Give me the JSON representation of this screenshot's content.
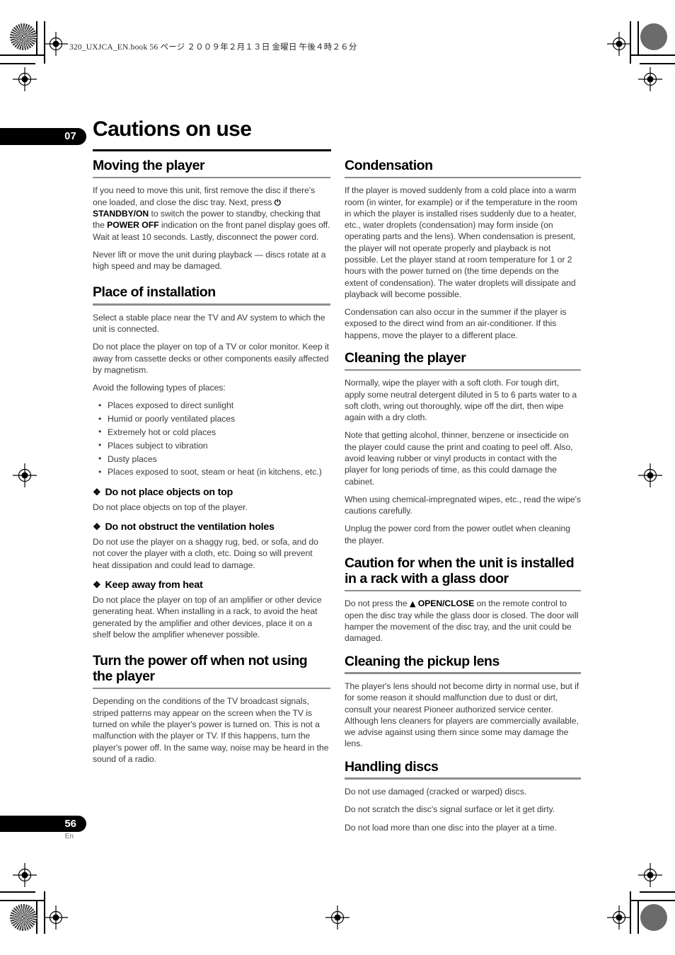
{
  "document": {
    "file_header": "320_UXJCA_EN.book   56 ページ   ２００９年２月１３日   金曜日   午後４時２６分",
    "chapter_number": "07",
    "page_title": "Cautions on use",
    "page_number": "56",
    "language_code": "En"
  },
  "left_column": {
    "moving": {
      "heading": "Moving the player",
      "p1_part1": "If you need to move this unit, first remove the disc if there's one loaded, and close the disc tray. Next, press ",
      "p1_power_icon": "⏻",
      "p1_bold1": "STANDBY/ON",
      "p1_part2": " to switch the power to standby, checking that the ",
      "p1_bold2": "POWER OFF",
      "p1_part3": " indication on the front panel display goes off. Wait at least 10 seconds. Lastly, disconnect the power cord.",
      "p2": "Never lift or move the unit during playback — discs rotate at a high speed and may be damaged."
    },
    "place": {
      "heading": "Place of installation",
      "p1": "Select a stable place near the TV and AV system to which the unit is connected.",
      "p2": "Do not place the player on top of a TV or color monitor. Keep it away from cassette decks or other components easily affected by magnetism.",
      "p3": "Avoid the following types of places:",
      "bullets": [
        "Places exposed to direct sunlight",
        "Humid or poorly ventilated places",
        "Extremely hot or cold places",
        "Places subject to vibration",
        "Dusty places",
        "Places exposed to soot, steam or heat (in kitchens, etc.)"
      ],
      "sub1": {
        "floret": "❖",
        "title": "Do not place objects on top",
        "body": "Do not place objects on top of the player."
      },
      "sub2": {
        "floret": "❖",
        "title": "Do not obstruct the ventilation holes",
        "body": "Do not use the player on a shaggy rug, bed, or sofa, and do not cover the player with a cloth, etc. Doing so will prevent heat dissipation and could lead to damage."
      },
      "sub3": {
        "floret": "❖",
        "title": "Keep away from heat",
        "body": "Do not place the player on top of an amplifier or other device generating heat. When installing in a rack, to avoid the heat generated by the amplifier and other devices, place it on a shelf below the amplifier whenever possible."
      }
    },
    "turn_off": {
      "heading": "Turn the power off when not using the player",
      "p1": "Depending on the conditions of the TV broadcast signals, striped patterns may appear on the screen when the TV is turned on while the player's power is turned on. This is not a malfunction with the player or TV. If this happens, turn the player's power off. In the same way, noise may be heard in the sound of a radio."
    }
  },
  "right_column": {
    "condensation": {
      "heading": "Condensation",
      "p1": "If the player is moved suddenly from a cold place into a warm room (in winter, for example) or if the temperature in the room in which the player is installed rises suddenly due to a heater, etc., water droplets (condensation) may form inside (on operating parts and the lens). When condensation is present, the player will not operate properly and playback is not possible. Let the player stand at room temperature for 1 or 2 hours with the power turned on (the time depends on the extent of condensation). The water droplets will dissipate and playback will become possible.",
      "p2": "Condensation can also occur in the summer if the player is exposed to the direct wind from an air-conditioner. If this happens, move the player to a different place."
    },
    "cleaning_player": {
      "heading": "Cleaning the player",
      "p1": "Normally, wipe the player with a soft cloth. For tough dirt, apply some neutral detergent diluted in 5 to 6 parts water to a soft cloth, wring out thoroughly, wipe off the dirt, then wipe again with a dry cloth.",
      "p2": "Note that getting alcohol, thinner, benzene or insecticide on the player could cause the print and coating to peel off. Also, avoid leaving rubber or vinyl products in contact with the player for long periods of time, as this could damage the cabinet.",
      "p3": "When using chemical-impregnated wipes, etc., read the wipe's cautions carefully.",
      "p4": "Unplug the power cord from the power outlet when cleaning the player."
    },
    "glass_door": {
      "heading": "Caution for when the unit is installed in a rack with a glass door",
      "p1_part1": "Do not press the ",
      "p1_eject_icon": "▲",
      "p1_bold": "OPEN/CLOSE",
      "p1_part2": " on the remote control to open the disc tray while the glass door is closed. The door will hamper the movement of the disc tray, and the unit could be damaged."
    },
    "pickup_lens": {
      "heading": "Cleaning the pickup lens",
      "p1": "The player's lens should not become dirty in normal use, but if for some reason it should malfunction due to dust or dirt, consult your nearest Pioneer authorized service center. Although lens cleaners for players are commercially available, we advise against using them since some may damage the lens."
    },
    "handling_discs": {
      "heading": "Handling discs",
      "p1": "Do not use damaged (cracked or warped) discs.",
      "p2": "Do not scratch the disc's signal surface or let it get dirty.",
      "p3": "Do not load more than one disc into the player at a time."
    }
  }
}
